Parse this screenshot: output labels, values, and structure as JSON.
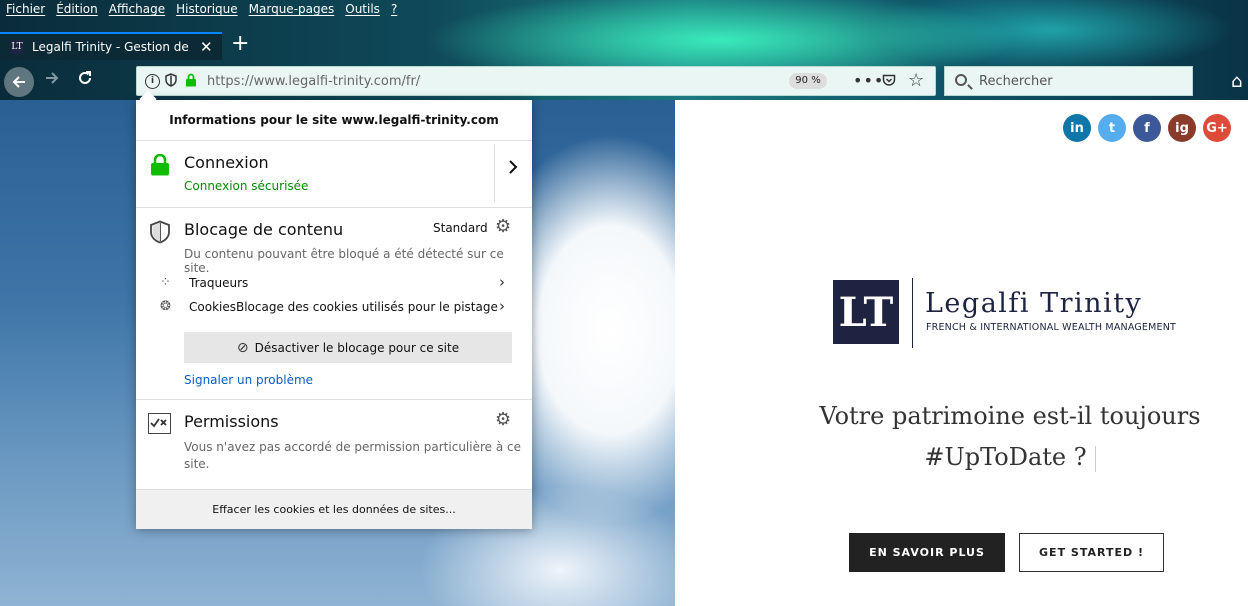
{
  "menubar": [
    "Fichier",
    "Édition",
    "Affichage",
    "Historique",
    "Marque-pages",
    "Outils",
    "?"
  ],
  "tab": {
    "title": "Legalfi Trinity - Gestion de patrimoine",
    "favicon": "LT"
  },
  "urlbar": {
    "url": "https://www.legalfi-trinity.com/fr/",
    "zoom": "90 %",
    "more": "•••"
  },
  "search": {
    "placeholder": "Rechercher"
  },
  "popup": {
    "header": "Informations pour le site www.legalfi-trinity.com",
    "connection": {
      "title": "Connexion",
      "status": "Connexion sécurisée"
    },
    "blocking": {
      "title": "Blocage de contenu",
      "mode": "Standard",
      "description": "Du contenu pouvant être bloqué a été détecté sur ce site.",
      "trackers": "Traqueurs",
      "cookies": "CookiesBlocage des cookies utilisés pour le pistage",
      "disable": "Désactiver le blocage pour ce site",
      "report": "Signaler un problème"
    },
    "permissions": {
      "title": "Permissions",
      "description": "Vous n'avez pas accordé de permission particulière à ce site."
    },
    "clear": "Effacer les cookies et les données de sites..."
  },
  "site": {
    "social": [
      "in",
      "t",
      "f",
      "ig",
      "G+"
    ],
    "logo": {
      "mark": "LT",
      "name": "Legalfi Trinity",
      "tagline": "FRENCH & INTERNATIONAL WEALTH MANAGEMENT"
    },
    "headline_line1": "Votre patrimoine est-il toujours",
    "headline_line2": "#UpToDate ?",
    "btn_learn": "EN SAVOIR PLUS",
    "btn_start": "GET STARTED !"
  },
  "colors": {
    "accent_blue": "#0a84ff",
    "secure_green": "#058b00",
    "brand_navy": "#1d2340",
    "link_blue": "#0a5cbf"
  }
}
